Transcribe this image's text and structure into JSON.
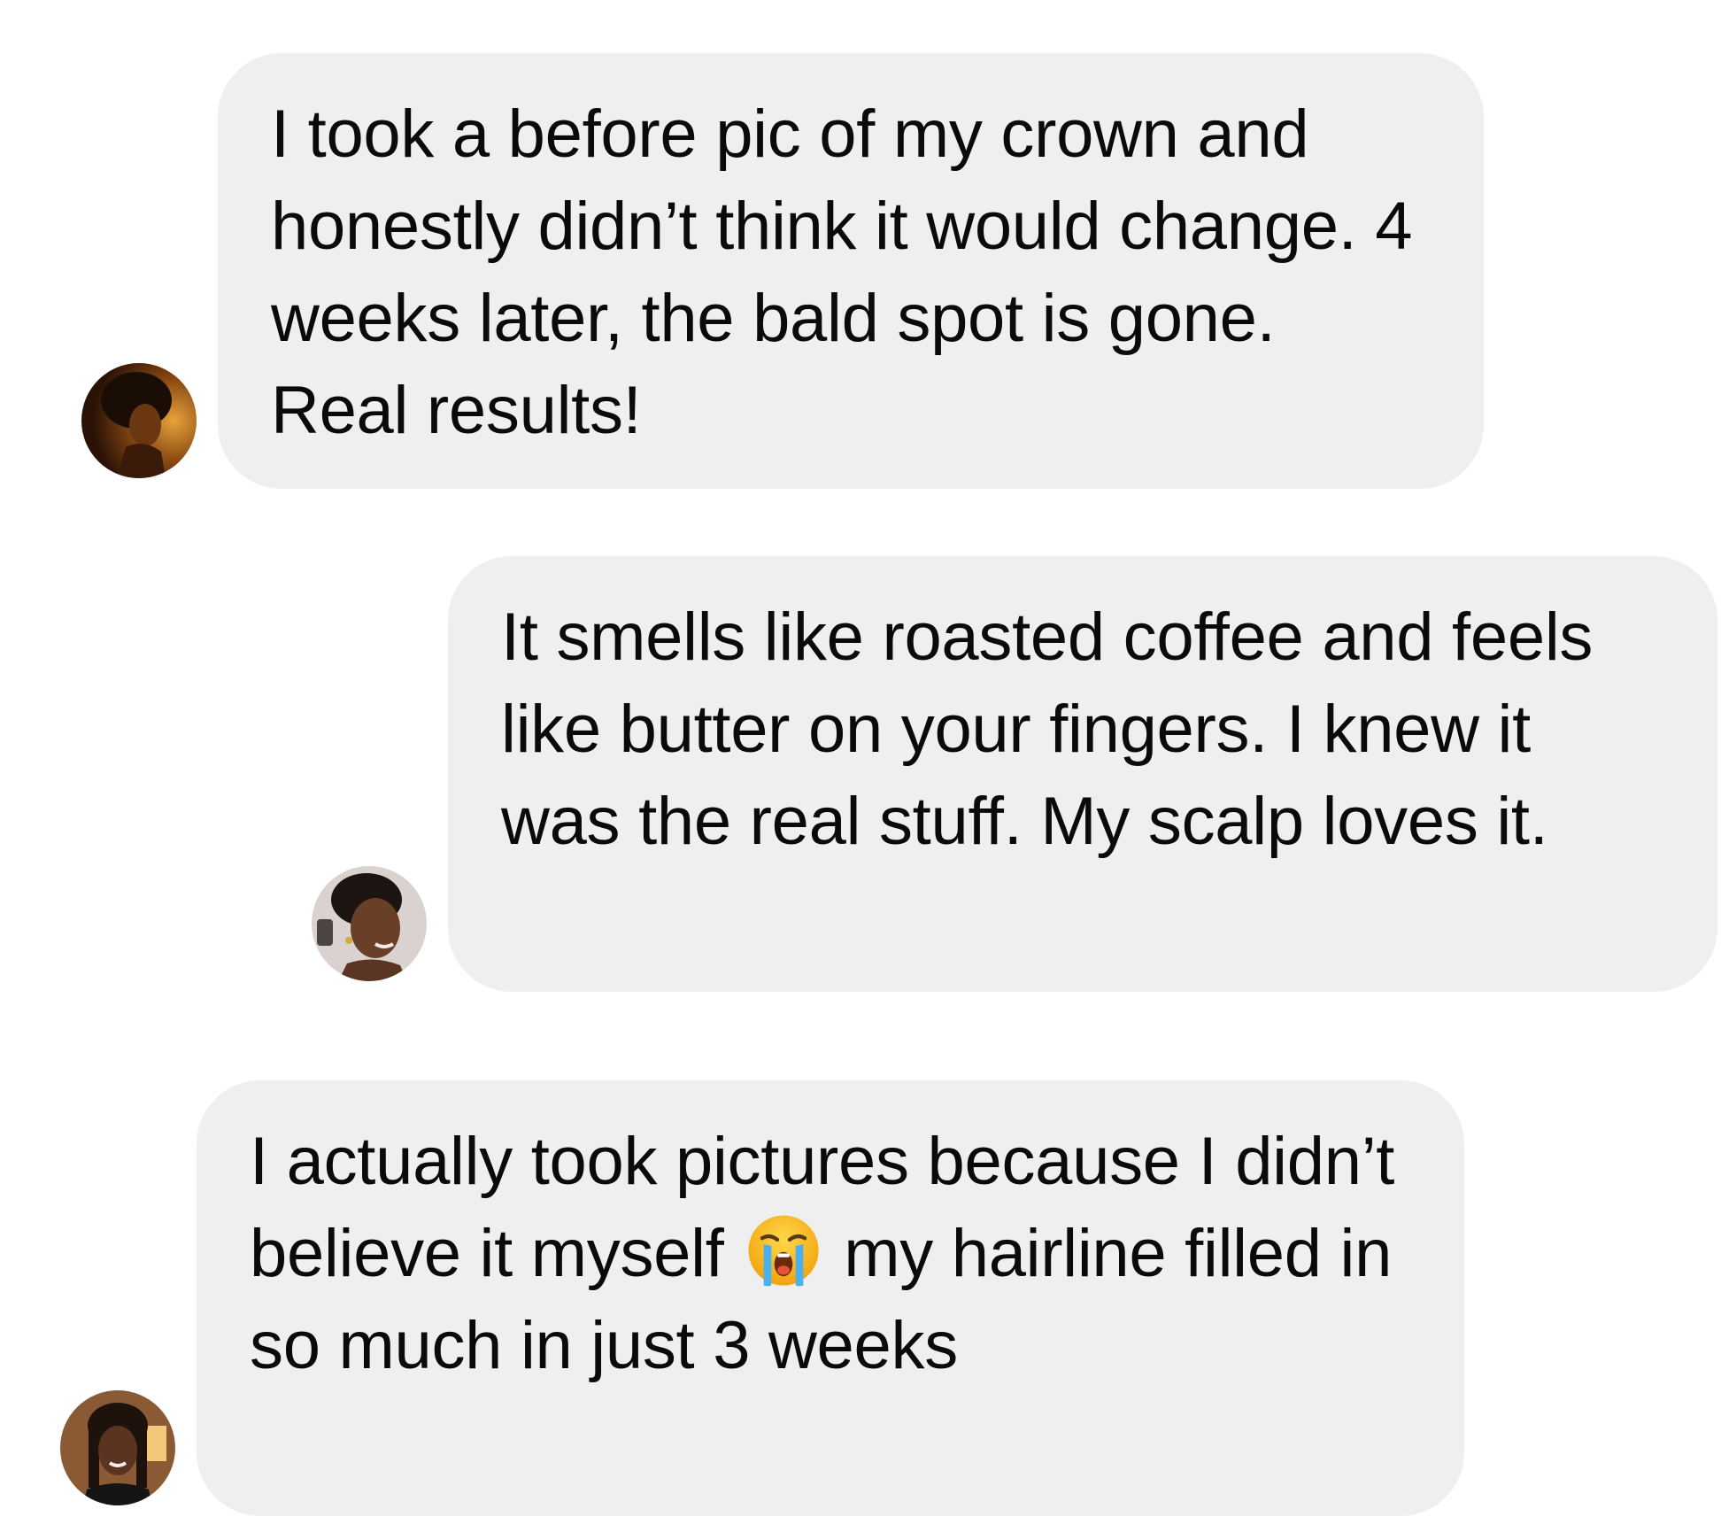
{
  "messages": [
    {
      "avatar_icon": "profile-photo-icon",
      "text": "I took a before pic of my crown and honestly didn’t think it would change. 4 weeks later, the bald spot is gone. Real results!"
    },
    {
      "avatar_icon": "profile-photo-icon",
      "text": "It smells like roasted coffee and feels like butter on your fingers. I knew it was the real stuff. My scalp loves it."
    },
    {
      "avatar_icon": "profile-photo-icon",
      "text_before_emoji": "I actually took pictures because I didn’t believe it myself",
      "emoji": "loudly-crying-face-icon",
      "text_after_emoji": "my hairline filled in so much in just 3 weeks"
    }
  ],
  "colors": {
    "bubble_background": "#efefef",
    "text": "#0a0a0a",
    "page_background": "#ffffff"
  }
}
